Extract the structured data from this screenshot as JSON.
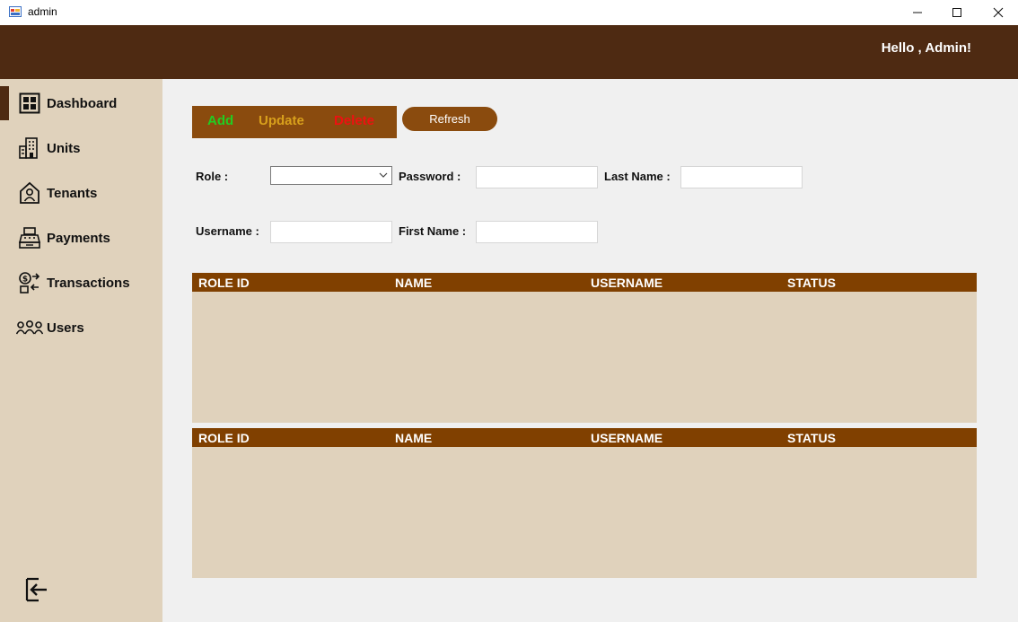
{
  "window": {
    "title": "admin",
    "icon": "app-form-icon"
  },
  "header": {
    "greeting": "Hello , Admin!"
  },
  "sidebar": {
    "items": [
      {
        "label": "Dashboard",
        "icon": "dashboard-grid-icon"
      },
      {
        "label": "Units",
        "icon": "building-icon"
      },
      {
        "label": "Tenants",
        "icon": "tenant-person-icon"
      },
      {
        "label": "Payments",
        "icon": "cash-register-icon"
      },
      {
        "label": "Transactions",
        "icon": "money-exchange-icon"
      },
      {
        "label": "Users",
        "icon": "users-group-icon"
      }
    ],
    "logout_icon": "logout-icon"
  },
  "toolbar": {
    "add_label": "Add",
    "update_label": "Update",
    "delete_label": "Delete",
    "refresh_label": "Refresh"
  },
  "form": {
    "role_label": "Role :",
    "role_value": "",
    "password_label": "Password :",
    "password_value": "",
    "last_name_label": "Last Name :",
    "last_name_value": "",
    "username_label": "Username :",
    "username_value": "",
    "first_name_label": "First Name :",
    "first_name_value": ""
  },
  "tables": [
    {
      "columns": [
        "ROLE ID",
        "NAME",
        "USERNAME",
        "STATUS"
      ],
      "rows": []
    },
    {
      "columns": [
        "ROLE ID",
        "NAME",
        "USERNAME",
        "STATUS"
      ],
      "rows": []
    }
  ],
  "colors": {
    "header_bg": "#4e2a12",
    "sidebar_bg": "#e0d2bc",
    "accent": "#8a4b0e",
    "table_header": "#804000",
    "add": "#22cc22",
    "update": "#d8a01c",
    "delete": "#ee1111"
  }
}
